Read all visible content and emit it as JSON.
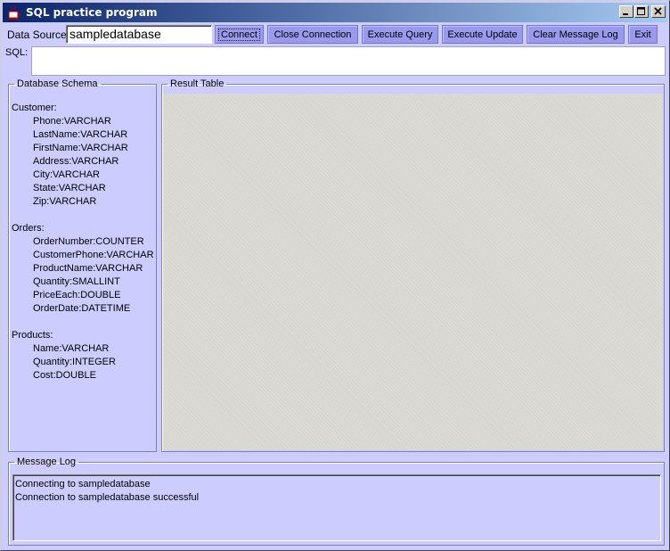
{
  "window": {
    "title": "SQL practice program",
    "icons": {
      "app": "java-cup-icon",
      "minimize": "minimize-icon",
      "maximize": "maximize-icon",
      "close": "close-icon"
    }
  },
  "toolbar": {
    "data_source_label": "Data Source:",
    "data_source_value": "sampledatabase",
    "buttons": {
      "connect": "Connect",
      "close_connection": "Close Connection",
      "execute_query": "Execute Query",
      "execute_update": "Execute Update",
      "clear_message_log": "Clear Message Log",
      "exit": "Exit"
    }
  },
  "sql": {
    "label": "SQL:",
    "value": ""
  },
  "schema": {
    "title": "Database Schema",
    "tables": [
      {
        "name": "Customer:",
        "fields": [
          "Phone:VARCHAR",
          "LastName:VARCHAR",
          "FirstName:VARCHAR",
          "Address:VARCHAR",
          "City:VARCHAR",
          "State:VARCHAR",
          "Zip:VARCHAR"
        ]
      },
      {
        "name": "Orders:",
        "fields": [
          "OrderNumber:COUNTER",
          "CustomerPhone:VARCHAR",
          "ProductName:VARCHAR",
          "Quantity:SMALLINT",
          "PriceEach:DOUBLE",
          "OrderDate:DATETIME"
        ]
      },
      {
        "name": "Products:",
        "fields": [
          "Name:VARCHAR",
          "Quantity:INTEGER",
          "Cost:DOUBLE"
        ]
      }
    ]
  },
  "result": {
    "title": "Result Table"
  },
  "message_log": {
    "title": "Message Log",
    "lines": [
      "Connecting to sampledatabase",
      "Connection to sampledatabase successful"
    ]
  },
  "colors": {
    "panel": "#ccccff",
    "button": "#9999ee",
    "titlebar": "#0a246a",
    "result_bg": "#d8d6d0"
  }
}
